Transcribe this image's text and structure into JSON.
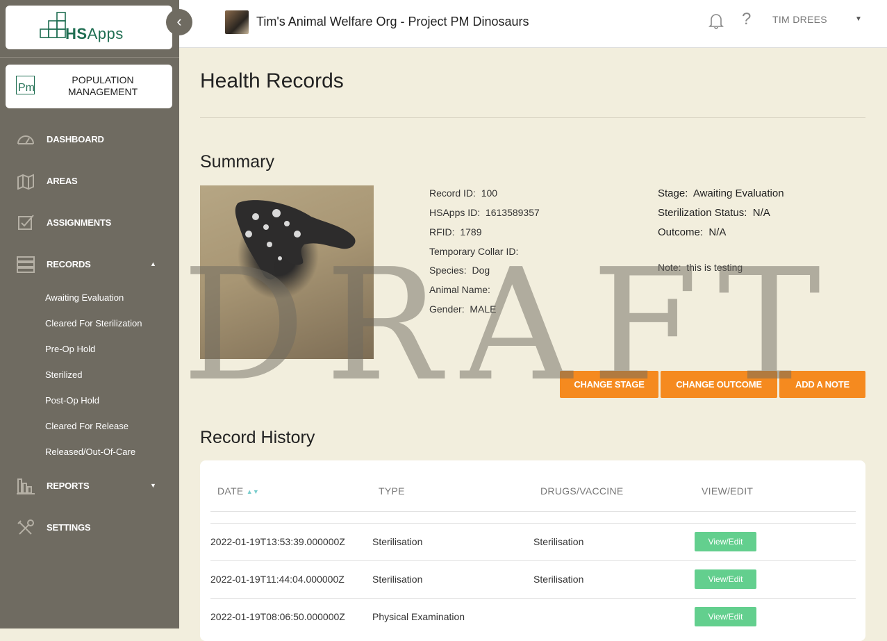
{
  "sidebar": {
    "logo_text_main": "HS",
    "logo_text_apps": "Apps",
    "module_icon": "Pm",
    "module_line1": "POPULATION",
    "module_line2": "MANAGEMENT",
    "nav": [
      {
        "label": "DASHBOARD",
        "icon": "dashboard-gauge-icon"
      },
      {
        "label": "AREAS",
        "icon": "map-icon"
      },
      {
        "label": "ASSIGNMENTS",
        "icon": "checkbox-icon"
      },
      {
        "label": "RECORDS",
        "icon": "records-stack-icon"
      },
      {
        "label": "REPORTS",
        "icon": "bar-chart-icon"
      },
      {
        "label": "SETTINGS",
        "icon": "tools-icon"
      }
    ],
    "records_sub": [
      "Awaiting Evaluation",
      "Cleared For Sterilization",
      "Pre-Op Hold",
      "Sterilized",
      "Post-Op Hold",
      "Cleared For Release",
      "Released/Out-Of-Care"
    ]
  },
  "topbar": {
    "org_title": "Tim's Animal Welfare Org - Project PM Dinosaurs",
    "help": "?",
    "user": "TIM DREES"
  },
  "page": {
    "title": "Health Records",
    "summary_title": "Summary",
    "history_title": "Record History",
    "watermark": "DRAFT"
  },
  "summary": {
    "record_id_label": "Record ID:",
    "record_id": "100",
    "hsapps_id_label": "HSApps ID:",
    "hsapps_id": "1613589357",
    "rfid_label": "RFID:",
    "rfid": "1789",
    "collar_label": "Temporary Collar ID:",
    "collar": "",
    "species_label": "Species:",
    "species": "Dog",
    "name_label": "Animal Name:",
    "name": "",
    "gender_label": "Gender:",
    "gender": "MALE",
    "stage_label": "Stage:",
    "stage": "Awaiting Evaluation",
    "sterilization_label": "Sterilization Status:",
    "sterilization": "N/A",
    "outcome_label": "Outcome:",
    "outcome": "N/A",
    "note_label": "Note:",
    "note": "this is testing"
  },
  "actions": {
    "change_stage": "CHANGE STAGE",
    "change_outcome": "CHANGE OUTCOME",
    "add_note": "ADD A NOTE"
  },
  "history": {
    "headers": [
      "DATE",
      "TYPE",
      "DRUGS/VACCINE",
      "VIEW/EDIT"
    ],
    "rows": [
      {
        "date": "2022-01-19T13:53:39.000000Z",
        "type": "Sterilisation",
        "drugs": "Sterilisation",
        "action": "View/Edit"
      },
      {
        "date": "2022-01-19T11:44:04.000000Z",
        "type": "Sterilisation",
        "drugs": "Sterilisation",
        "action": "View/Edit"
      },
      {
        "date": "2022-01-19T08:06:50.000000Z",
        "type": "Physical Examination",
        "drugs": "",
        "action": "View/Edit"
      }
    ]
  },
  "colors": {
    "sidebar": "#6f6b61",
    "accent_orange": "#f58a1f",
    "accent_green": "#63cf8e",
    "brand": "#1f6e52",
    "background": "#f2eedd"
  }
}
